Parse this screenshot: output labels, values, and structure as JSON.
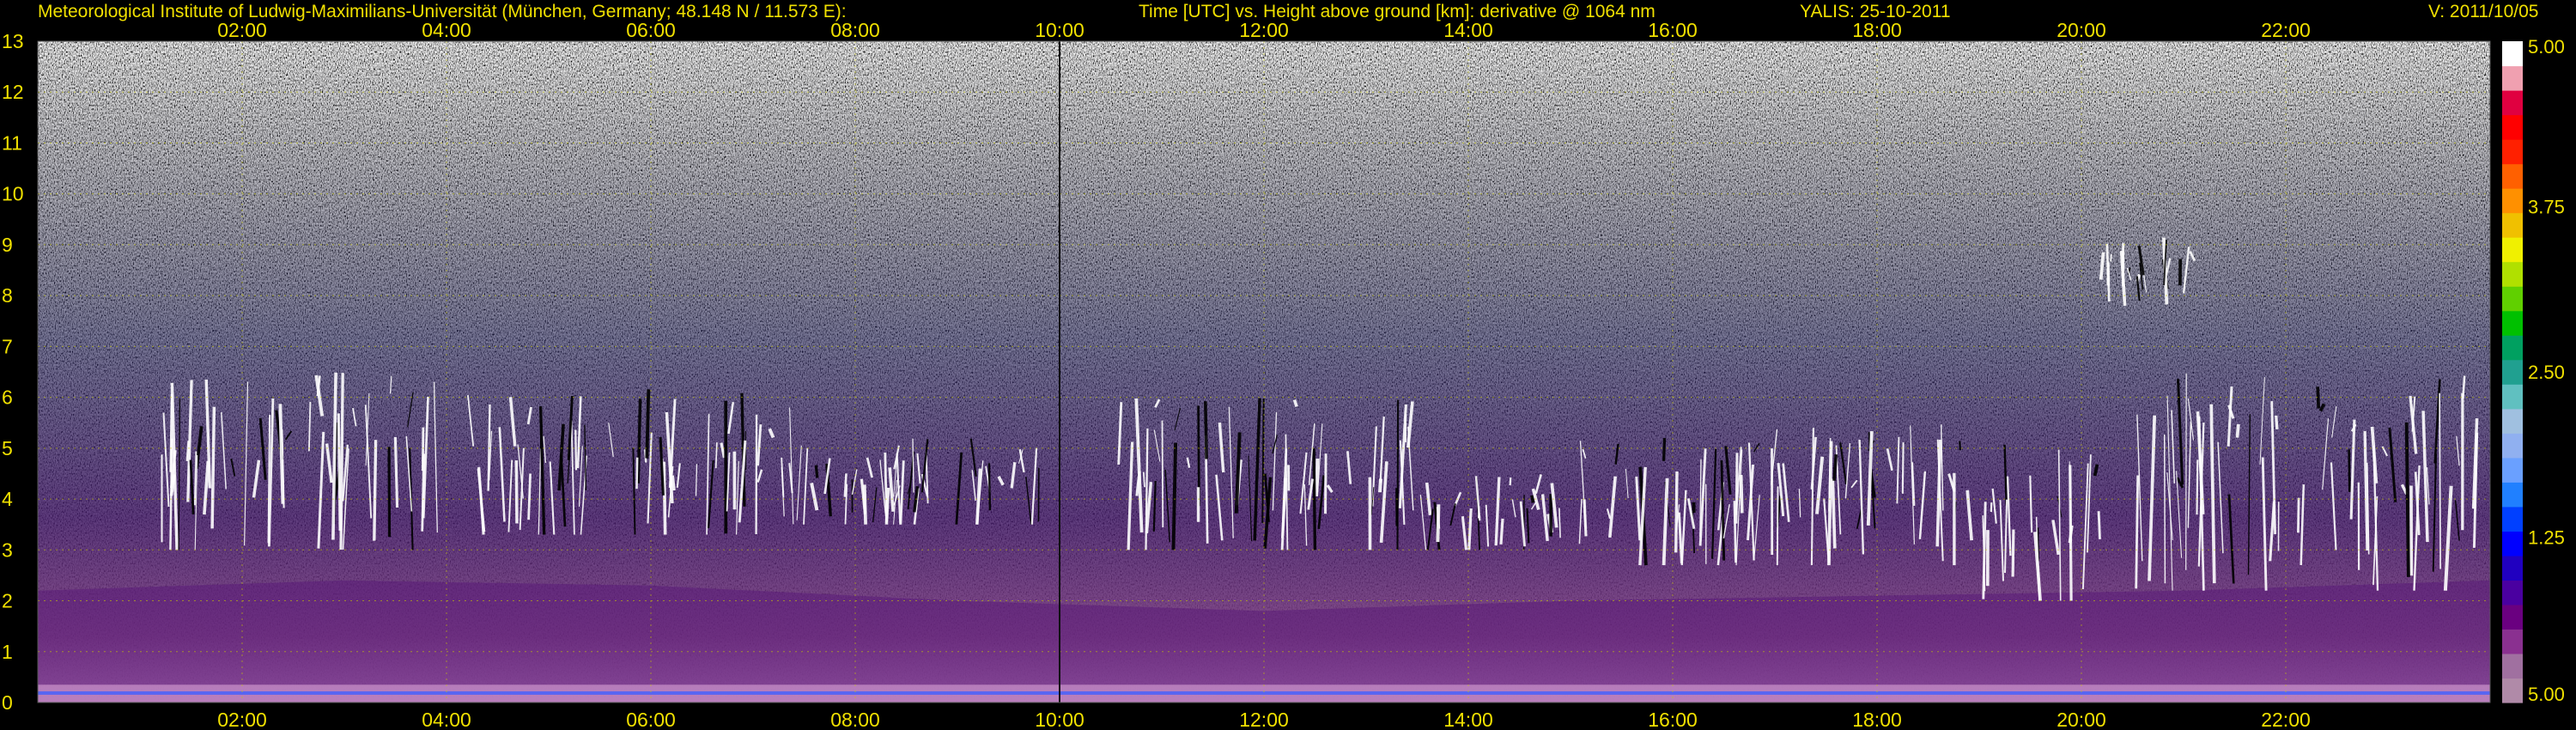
{
  "header": {
    "institute": "Meteorological Institute of Ludwig-Maximilians-Universität (München, Germany; 48.148 N / 11.573 E):",
    "plot_description": "Time [UTC] vs. Height above ground [km]: derivative @ 1064 nm",
    "instrument_date": "YALIS: 25-10-2011",
    "version": "V: 2011/10/05"
  },
  "chart_data": {
    "type": "heatmap",
    "title": "Time [UTC] vs. Height above ground [km]: derivative @ 1064 nm",
    "xlabel": "Time [UTC]",
    "ylabel": "Height above ground [km]",
    "x_range_hours": [
      0,
      24
    ],
    "ylim": [
      0,
      13
    ],
    "x_ticks": [
      "02:00",
      "04:00",
      "06:00",
      "08:00",
      "10:00",
      "12:00",
      "14:00",
      "16:00",
      "18:00",
      "20:00",
      "22:00"
    ],
    "x_tick_hours": [
      2,
      4,
      6,
      8,
      10,
      12,
      14,
      16,
      18,
      20,
      22
    ],
    "y_ticks": [
      0,
      1,
      2,
      3,
      4,
      5,
      6,
      7,
      8,
      9,
      10,
      11,
      12,
      13
    ],
    "grid": true,
    "grid_color": "#c8c800",
    "background_noise": "grey-white speckle above ~5 km",
    "colorbar": {
      "tick_labels": [
        "5.00",
        "3.75",
        "2.50",
        "1.25",
        "5.00"
      ],
      "tick_fractions": [
        1.0,
        0.75,
        0.5,
        0.25,
        0.0
      ],
      "colors": [
        "#b08aa8",
        "#a070a0",
        "#8a3090",
        "#6a0080",
        "#4a00a0",
        "#2000c0",
        "#0000ff",
        "#0040ff",
        "#2080ff",
        "#6aa0ff",
        "#90b0f0",
        "#a0c0e0",
        "#60c0c0",
        "#20a090",
        "#00a060",
        "#00c000",
        "#60d000",
        "#b0e000",
        "#f0f000",
        "#f0c000",
        "#ff9000",
        "#ff6000",
        "#ff2000",
        "#ff0000",
        "#e00040",
        "#f0a0b0",
        "#ffffff"
      ]
    },
    "cloud_layers": [
      {
        "start_h": 1.2,
        "end_h": 3.9,
        "base_km": 3.0,
        "top_km": 6.5
      },
      {
        "start_h": 4.2,
        "end_h": 7.5,
        "base_km": 3.3,
        "top_km": 6.2
      },
      {
        "start_h": 7.5,
        "end_h": 9.8,
        "base_km": 3.5,
        "top_km": 5.2
      },
      {
        "start_h": 10.5,
        "end_h": 13.5,
        "base_km": 3.0,
        "top_km": 6.0
      },
      {
        "start_h": 13.5,
        "end_h": 15.0,
        "base_km": 3.0,
        "top_km": 4.5
      },
      {
        "start_h": 15.0,
        "end_h": 17.0,
        "base_km": 2.7,
        "top_km": 5.2
      },
      {
        "start_h": 17.0,
        "end_h": 18.9,
        "base_km": 2.7,
        "top_km": 5.5
      },
      {
        "start_h": 19.0,
        "end_h": 20.2,
        "base_km": 2.0,
        "top_km": 5.2
      },
      {
        "start_h": 20.5,
        "end_h": 23.9,
        "base_km": 2.2,
        "top_km": 6.5
      },
      {
        "start_h": 20.2,
        "end_h": 21.2,
        "base_km": 7.8,
        "top_km": 9.2
      }
    ],
    "boundary_layer_top_km": [
      [
        0,
        2.2
      ],
      [
        3,
        2.4
      ],
      [
        6,
        2.3
      ],
      [
        9,
        2.0
      ],
      [
        12,
        1.8
      ],
      [
        15,
        2.0
      ],
      [
        18,
        2.1
      ],
      [
        21,
        2.2
      ],
      [
        24,
        2.4
      ]
    ]
  }
}
